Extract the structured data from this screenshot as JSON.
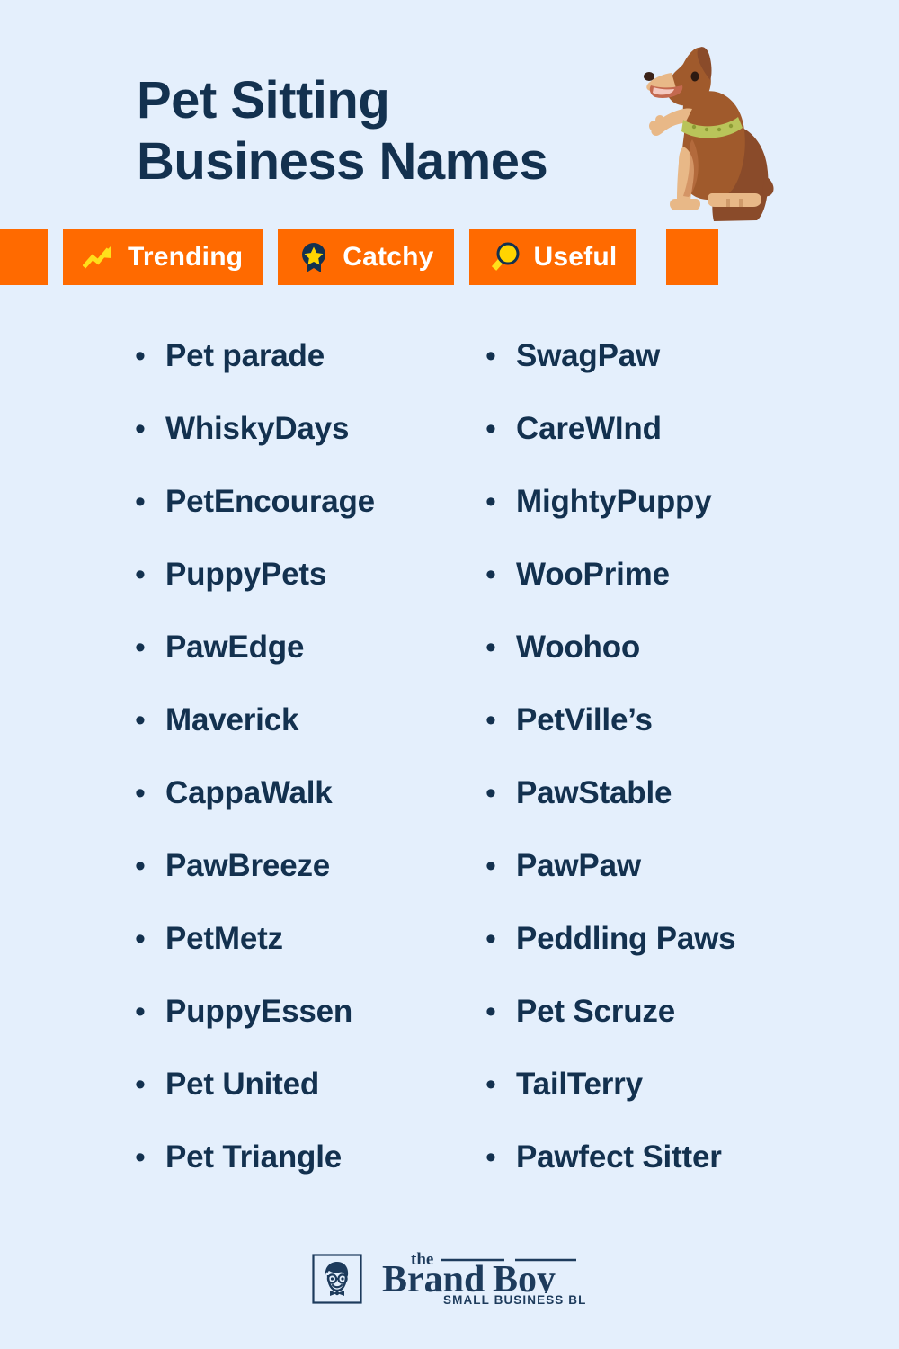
{
  "page": {
    "background_color": "#e4effc",
    "text_color": "#13314f",
    "accent_color": "#ff6a00",
    "icon_yellow": "#ffe01b"
  },
  "header": {
    "title_line1": "Pet Sitting",
    "title_line2": "Business Names",
    "title": "Pet Sitting\nBusiness Names",
    "illustration": "sitting-dog-illustration"
  },
  "badges": [
    {
      "label": "Trending",
      "icon": "trending-up-arrow-icon"
    },
    {
      "label": "Catchy",
      "icon": "award-ribbon-star-icon"
    },
    {
      "label": "Useful",
      "icon": "magnifying-glass-icon"
    }
  ],
  "columns": {
    "left": [
      {
        "label": "Pet parade"
      },
      {
        "label": "WhiskyDays"
      },
      {
        "label": "PetEncourage"
      },
      {
        "label": "PuppyPets"
      },
      {
        "label": "PawEdge"
      },
      {
        "label": "Maverick"
      },
      {
        "label": "CappaWalk"
      },
      {
        "label": "PawBreeze"
      },
      {
        "label": "PetMetz"
      },
      {
        "label": "PuppyEssen"
      },
      {
        "label": "Pet United"
      },
      {
        "label": "Pet Triangle"
      }
    ],
    "right": [
      {
        "label": "SwagPaw"
      },
      {
        "label": "CareWInd"
      },
      {
        "label": "MightyPuppy"
      },
      {
        "label": "WooPrime"
      },
      {
        "label": "Woohoo"
      },
      {
        "label": "PetVille’s"
      },
      {
        "label": "PawStable"
      },
      {
        "label": "PawPaw"
      },
      {
        "label": "Peddling Paws"
      },
      {
        "label": "Pet Scruze"
      },
      {
        "label": "TailTerry"
      },
      {
        "label": "Pawfect Sitter"
      }
    ]
  },
  "footer": {
    "logo_the": "the",
    "logo_brand": "Brand",
    "logo_boy": "Boy",
    "logo_tagline": "SMALL BUSINESS BLOG",
    "logo_mark": "brandboy-face-icon"
  }
}
